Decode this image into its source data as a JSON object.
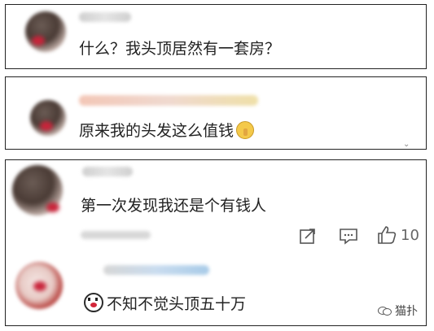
{
  "comments": [
    {
      "text": "什么？我头顶居然有一套房？"
    },
    {
      "text": "原来我的头发这么值钱",
      "emoji": "shushing-face-emoji"
    },
    {
      "text": "第一次发现我还是个有钱人",
      "like_count": "10"
    },
    {
      "text": "不知不觉头顶五十万",
      "emoji": "shocked-face-emoji"
    }
  ],
  "watermark": {
    "label": "猫扑"
  },
  "colors": {
    "border": "#222222",
    "text": "#222222",
    "blush": "#c8243a"
  }
}
